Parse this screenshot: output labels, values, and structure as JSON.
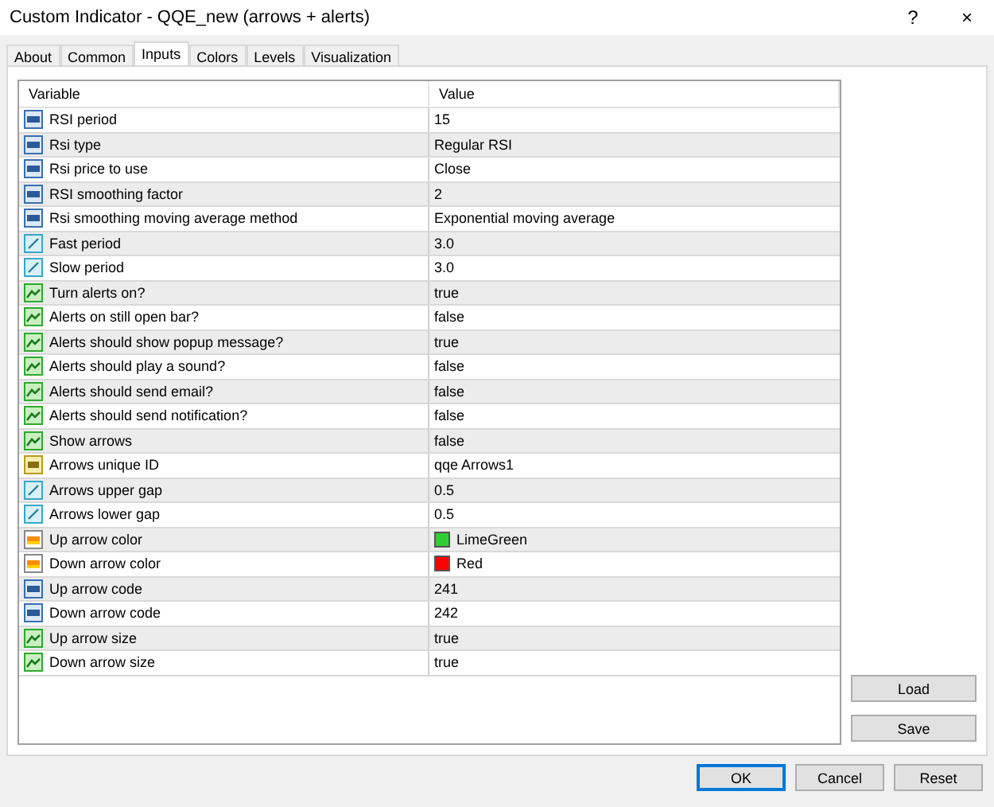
{
  "window": {
    "title": "Custom Indicator - QQE_new (arrows + alerts)",
    "help": "?",
    "close": "×"
  },
  "tabs": [
    {
      "label": "About",
      "selected": false
    },
    {
      "label": "Common",
      "selected": false
    },
    {
      "label": "Inputs",
      "selected": true
    },
    {
      "label": "Colors",
      "selected": false
    },
    {
      "label": "Levels",
      "selected": false
    },
    {
      "label": "Visualization",
      "selected": false
    }
  ],
  "table": {
    "columns": [
      "Variable",
      "Value"
    ],
    "rows": [
      {
        "kind": "int",
        "variable": "RSI period",
        "value": "15"
      },
      {
        "kind": "int",
        "variable": "Rsi type",
        "value": "Regular RSI"
      },
      {
        "kind": "int",
        "variable": "Rsi price to use",
        "value": "Close"
      },
      {
        "kind": "int",
        "variable": "RSI smoothing factor",
        "value": "2"
      },
      {
        "kind": "int",
        "variable": "Rsi smoothing moving average method",
        "value": "Exponential moving average"
      },
      {
        "kind": "double",
        "variable": "Fast period",
        "value": "3.0"
      },
      {
        "kind": "double",
        "variable": "Slow period",
        "value": "3.0"
      },
      {
        "kind": "bool",
        "variable": "Turn alerts on?",
        "value": "true"
      },
      {
        "kind": "bool",
        "variable": "Alerts on still open bar?",
        "value": "false"
      },
      {
        "kind": "bool",
        "variable": "Alerts should show popup message?",
        "value": "true"
      },
      {
        "kind": "bool",
        "variable": "Alerts should play a sound?",
        "value": "false"
      },
      {
        "kind": "bool",
        "variable": "Alerts should send email?",
        "value": "false"
      },
      {
        "kind": "bool",
        "variable": "Alerts should send notification?",
        "value": "false"
      },
      {
        "kind": "bool",
        "variable": "Show arrows",
        "value": "false"
      },
      {
        "kind": "string",
        "variable": "Arrows unique ID",
        "value": "qqe Arrows1"
      },
      {
        "kind": "double",
        "variable": "Arrows upper gap",
        "value": "0.5"
      },
      {
        "kind": "double",
        "variable": "Arrows lower gap",
        "value": "0.5"
      },
      {
        "kind": "color",
        "variable": "Up arrow color",
        "value": "LimeGreen",
        "color": "#32cd32"
      },
      {
        "kind": "color",
        "variable": "Down arrow color",
        "value": "Red",
        "color": "#ff0000"
      },
      {
        "kind": "int",
        "variable": "Up arrow code",
        "value": "241"
      },
      {
        "kind": "int",
        "variable": "Down arrow code",
        "value": "242"
      },
      {
        "kind": "bool",
        "variable": "Up arrow size",
        "value": "true"
      },
      {
        "kind": "bool",
        "variable": "Down arrow size",
        "value": "true"
      }
    ]
  },
  "side_buttons": [
    "Load",
    "Save"
  ],
  "buttons": [
    {
      "label": "OK",
      "default": true
    },
    {
      "label": "Cancel",
      "default": false
    },
    {
      "label": "Reset",
      "default": false
    }
  ]
}
